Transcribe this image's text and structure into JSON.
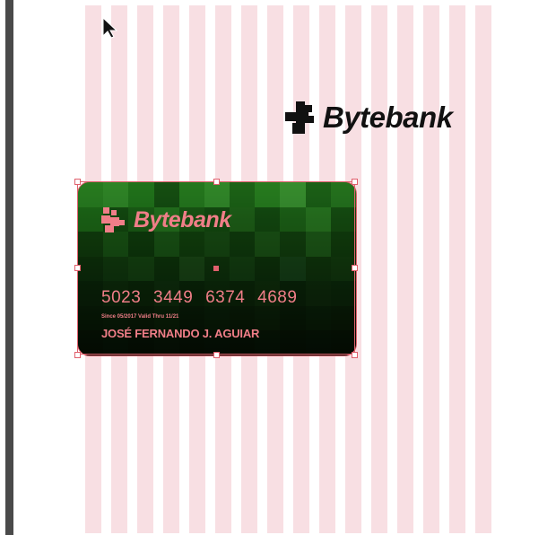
{
  "brand": {
    "name": "Bytebank",
    "icon": "bytebank-logo-icon"
  },
  "card": {
    "brand": "Bytebank",
    "number": "5023 3449 6374 4689",
    "dates": "Since 05/2017  Valid Thru 11/21",
    "holder": "JOSÉ FERNANDO J. AGUIAR"
  },
  "colors": {
    "guide": "#f8dfe3",
    "selection": "#e0606d",
    "card_text": "#f07e88"
  }
}
